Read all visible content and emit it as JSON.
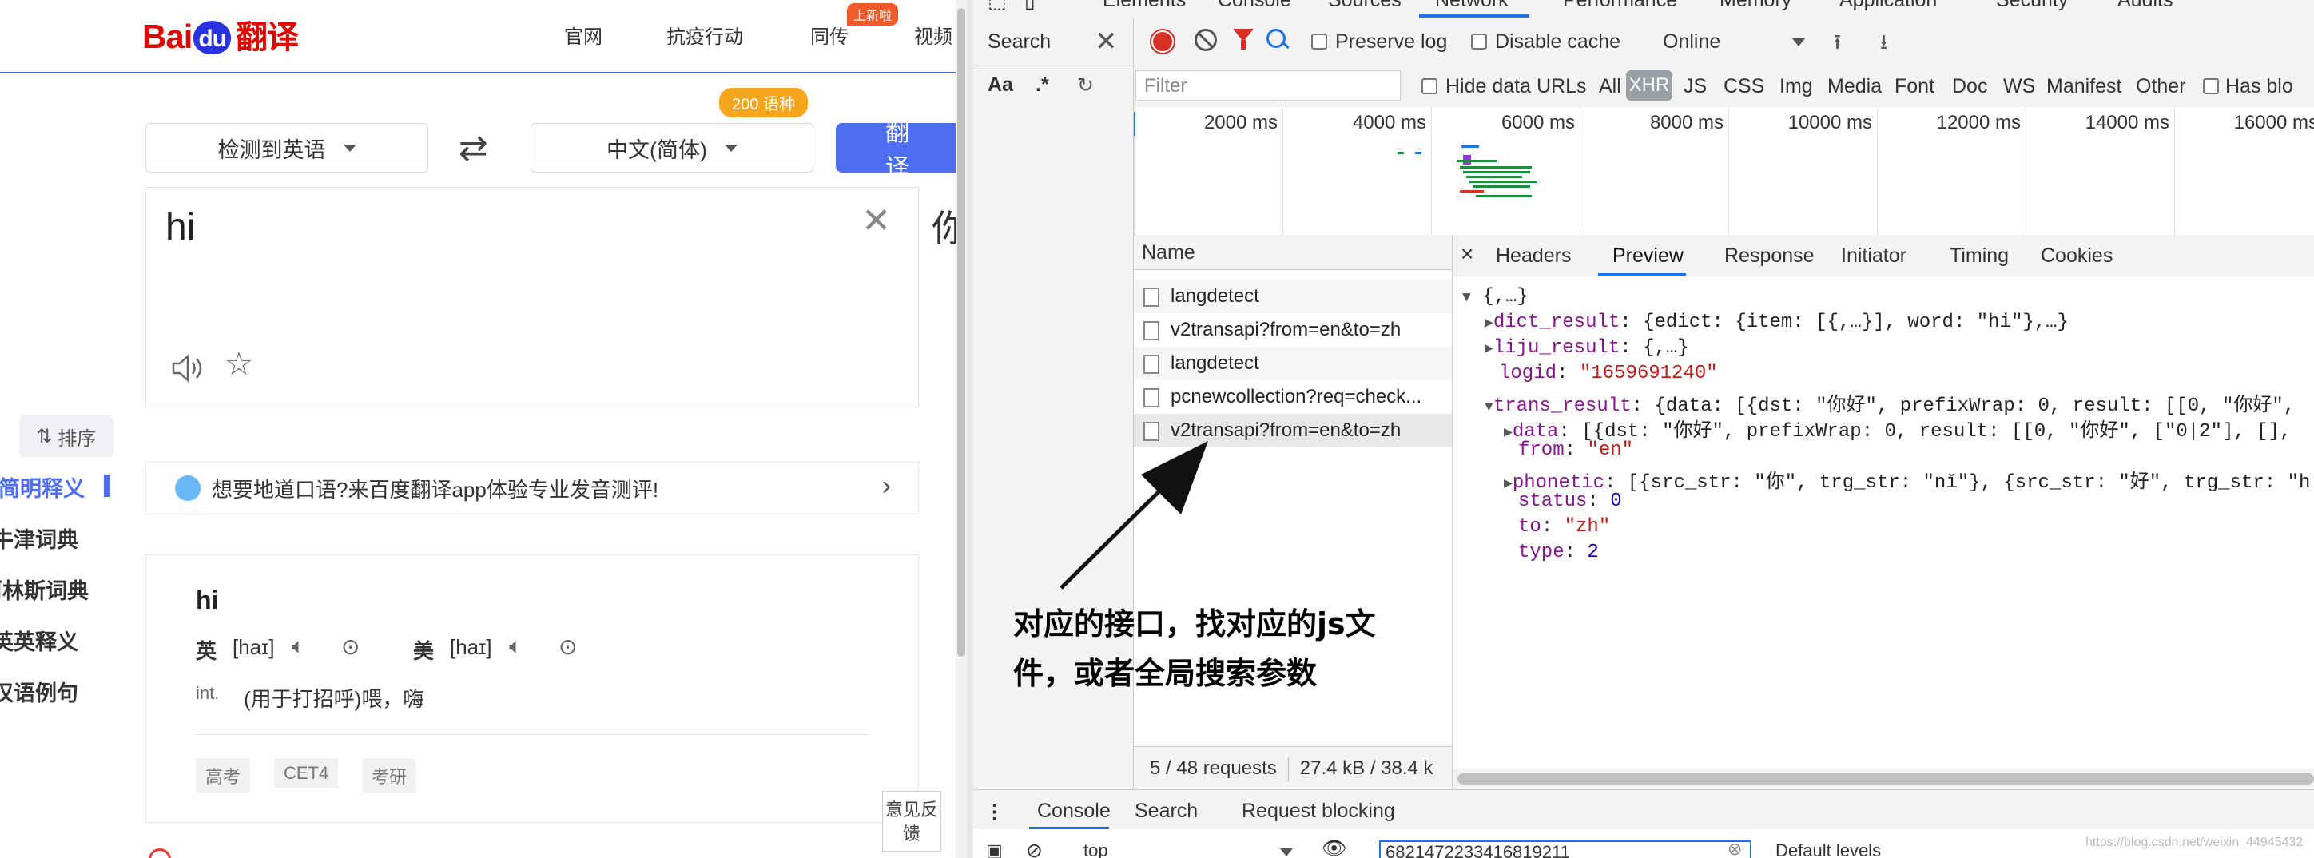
{
  "baidu": {
    "logo_text": "Bai",
    "logo_du": "du",
    "logo_suffix": "翻译",
    "nav": [
      "官网",
      "抗疫行动",
      "同传",
      "视频"
    ],
    "nav_badge": "上新啦",
    "source_lang": "检测到英语",
    "target_lang": "中文(简体)",
    "lang_count_badge": "200 语种",
    "translate_button": "翻译",
    "input_text": "hi",
    "result_peek": "你",
    "sort_label": "排序",
    "sidebar": [
      "简明释义",
      "牛津词典",
      "柯林斯词典",
      "英英释义",
      "汉语例句"
    ],
    "promo_text": "想要地道口语?来百度翻译app体验专业发音测评!",
    "dict": {
      "word": "hi",
      "uk_label": "英",
      "uk_phon": "[haɪ]",
      "us_label": "美",
      "us_phon": "[haɪ]",
      "pos": "int.",
      "meaning": "(用于打招呼)喂，嗨",
      "tags": [
        "高考",
        "CET4",
        "考研"
      ]
    },
    "feedback": "意见反馈"
  },
  "devtools": {
    "main_tabs": [
      "Elements",
      "Console",
      "Sources",
      "Network",
      "Performance",
      "Memory",
      "Application",
      "Security",
      "Audits"
    ],
    "active_main_tab": "Network",
    "search_pane": {
      "title": "Search",
      "aa": "Aa",
      "regex": ".*"
    },
    "toolbar": {
      "preserve_log": "Preserve log",
      "disable_cache": "Disable cache",
      "throttle": "Online"
    },
    "filter": {
      "placeholder": "Filter",
      "hide_data_urls": "Hide data URLs",
      "types": [
        "All",
        "XHR",
        "JS",
        "CSS",
        "Img",
        "Media",
        "Font",
        "Doc",
        "WS",
        "Manifest",
        "Other"
      ],
      "active_type": "XHR",
      "has_blocked": "Has blo"
    },
    "timeline_ticks": [
      "2000 ms",
      "4000 ms",
      "6000 ms",
      "8000 ms",
      "10000 ms",
      "12000 ms",
      "14000 ms",
      "16000 ms"
    ],
    "name_header": "Name",
    "requests": [
      "langdetect",
      "v2transapi?from=en&to=zh",
      "langdetect",
      "pcnewcollection?req=check...",
      "v2transapi?from=en&to=zh"
    ],
    "footer": {
      "requests": "5 / 48 requests",
      "size": "27.4 kB / 38.4 k"
    },
    "detail_tabs": [
      "Headers",
      "Preview",
      "Response",
      "Initiator",
      "Timing",
      "Cookies"
    ],
    "active_detail_tab": "Preview",
    "preview": {
      "root": "{,…}",
      "dict_result_key": "dict_result",
      "dict_result_val": "{edict: {item: [{,…}], word: \"hi\"},…}",
      "liju_key": "liju_result",
      "liju_val": "{,…}",
      "logid_key": "logid",
      "logid_val": "\"1659691240\"",
      "trans_key": "trans_result",
      "trans_val": "{data: [{dst: \"你好\", prefixWrap: 0, result: [[0, \"你好\",",
      "data_key": "data",
      "data_val": "[{dst: \"你好\", prefixWrap: 0, result: [[0, \"你好\", [\"0|2\"], [],",
      "from_key": "from",
      "from_val": "\"en\"",
      "phonetic_key": "phonetic",
      "phonetic_val": "[{src_str: \"你\", trg_str: \"nǐ\"}, {src_str: \"好\", trg_str: \"h",
      "status_key": "status",
      "status_val": "0",
      "to_key": "to",
      "to_val": "\"zh\"",
      "type_key": "type",
      "type_val": "2"
    },
    "console_tabs": [
      "Console",
      "Search",
      "Request blocking"
    ],
    "active_console_tab": "Console",
    "context": "top",
    "console_input": "6821472233416819211",
    "log_levels": "Default levels"
  },
  "annotation": {
    "line1": "对应的接口，找对应的js文",
    "line2": "件，或者全局搜索参数"
  },
  "watermark": "https://blog.csdn.net/weixin_44945432"
}
